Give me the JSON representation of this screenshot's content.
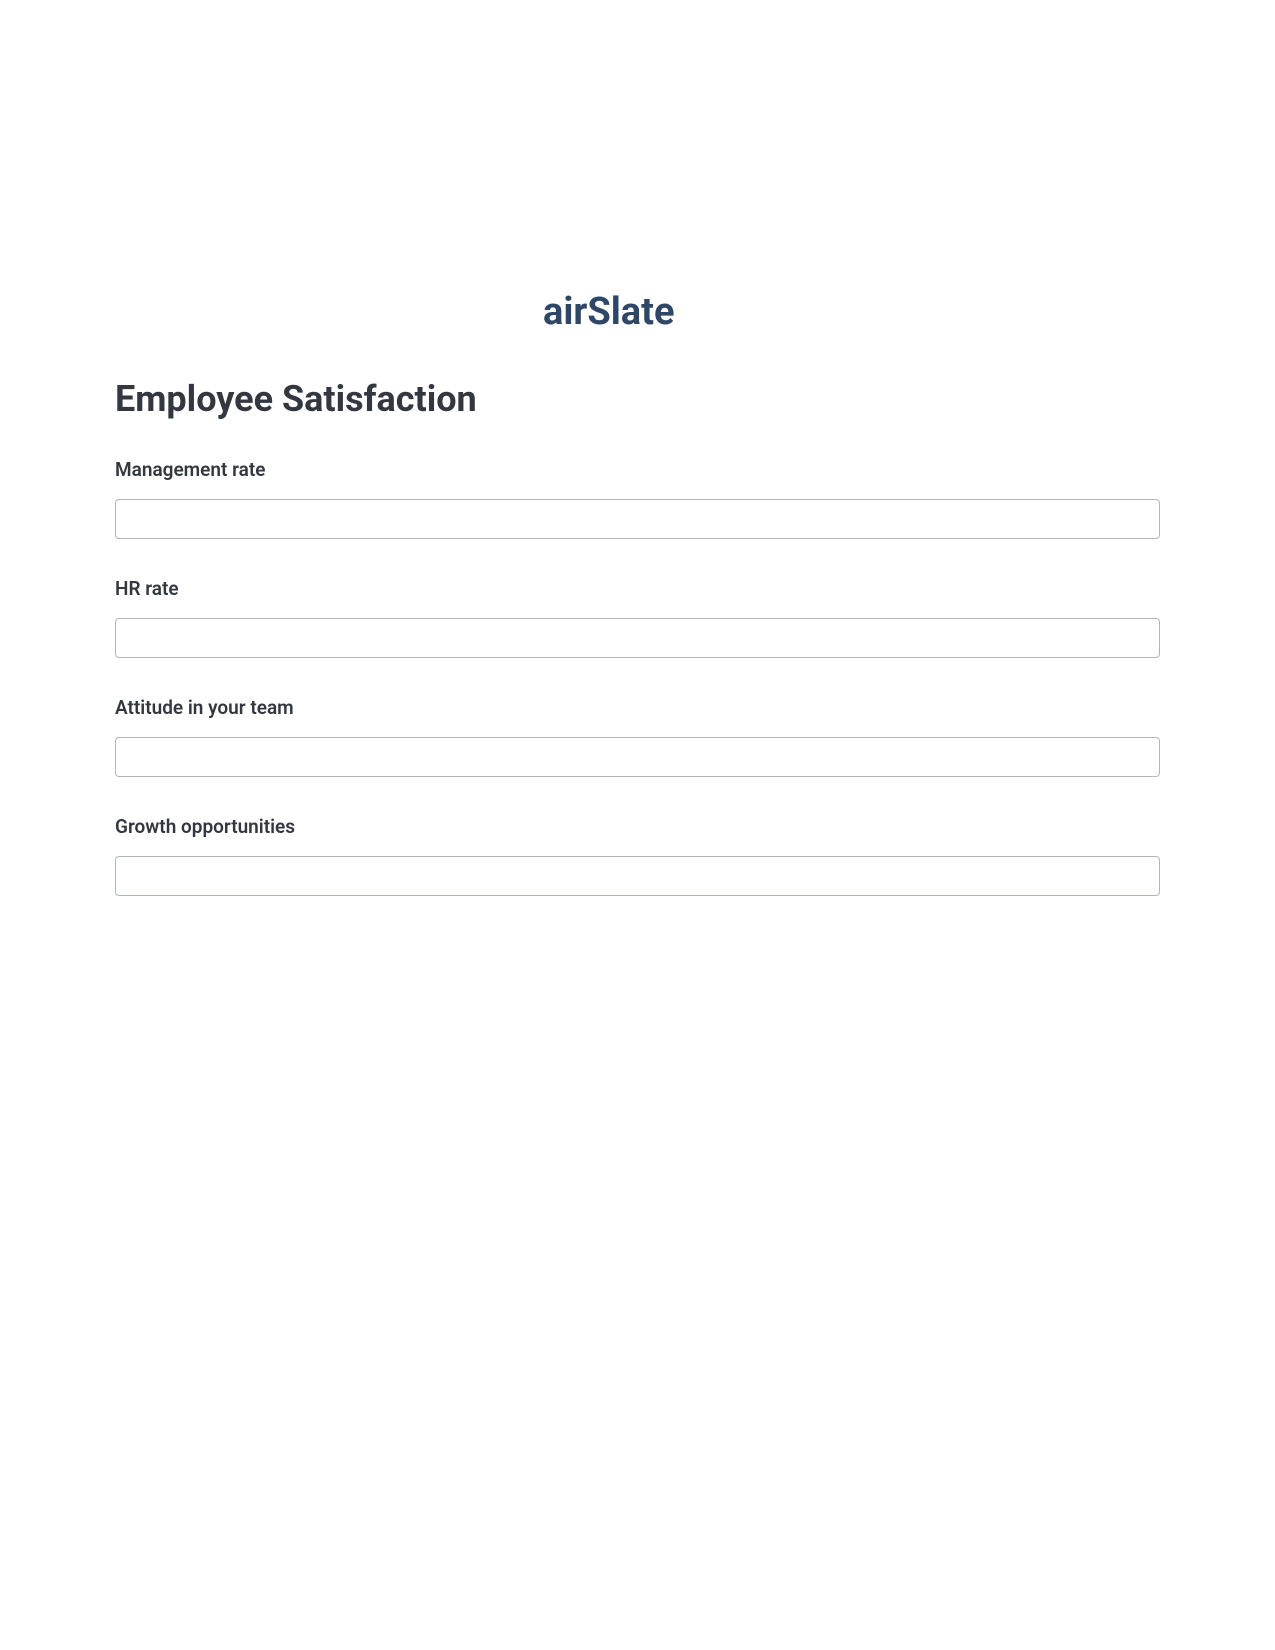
{
  "brand": {
    "name": "airSlate",
    "color": "#2e4766"
  },
  "form": {
    "title": "Employee Satisfaction",
    "fields": [
      {
        "label": "Management rate",
        "value": ""
      },
      {
        "label": "HR rate",
        "value": ""
      },
      {
        "label": "Attitude in your team",
        "value": ""
      },
      {
        "label": "Growth opportunities",
        "value": ""
      }
    ]
  }
}
